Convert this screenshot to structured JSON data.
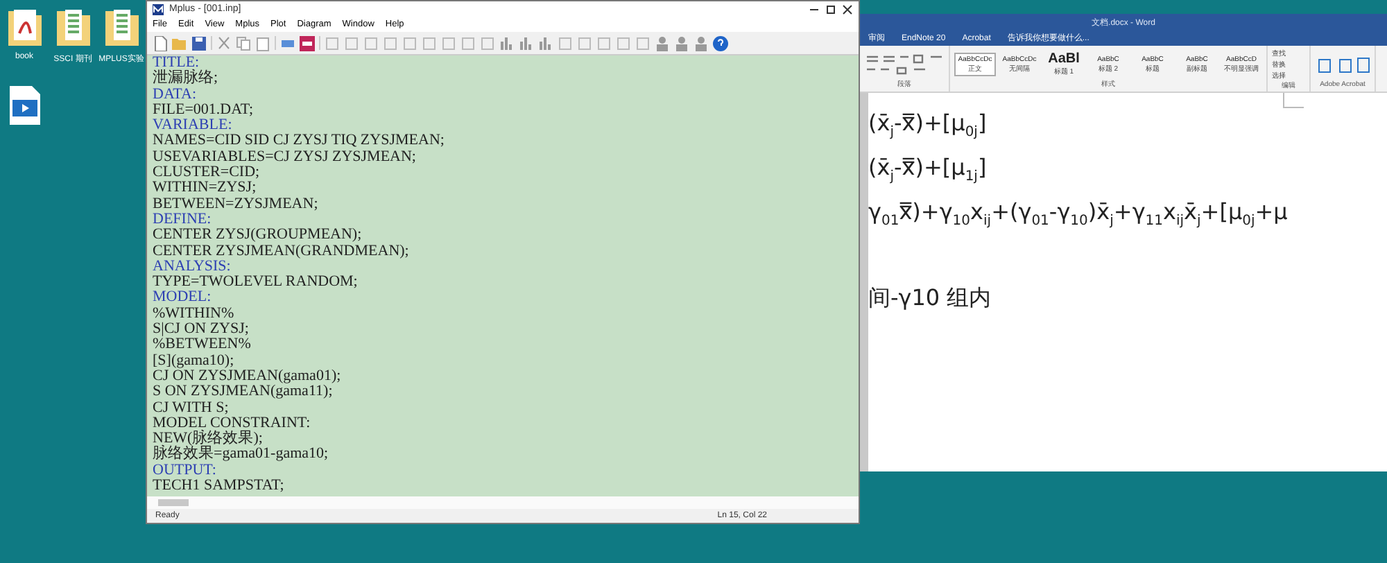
{
  "desktop_icons": [
    {
      "label": "book",
      "kind": "pdf-folder"
    },
    {
      "label": "SSCI 期刊",
      "kind": "folder"
    },
    {
      "label": "MPLUS实验",
      "kind": "folder"
    },
    {
      "kind": "video"
    }
  ],
  "mplus": {
    "title": "Mplus - [001.inp]",
    "menu": [
      "File",
      "Edit",
      "View",
      "Mplus",
      "Plot",
      "Diagram",
      "Window",
      "Help"
    ],
    "lines": [
      {
        "text": "TITLE:",
        "kind": "keyword"
      },
      {
        "text": "泄漏脉络;",
        "kind": "code"
      },
      {
        "text": "DATA:",
        "kind": "keyword"
      },
      {
        "text": "FILE=001.DAT;",
        "kind": "code"
      },
      {
        "text": "VARIABLE:",
        "kind": "keyword"
      },
      {
        "text": "NAMES=CID SID CJ ZYSJ TIQ ZYSJMEAN;",
        "kind": "code"
      },
      {
        "text": "USEVARIABLES=CJ ZYSJ ZYSJMEAN;",
        "kind": "code"
      },
      {
        "text": "CLUSTER=CID;",
        "kind": "code"
      },
      {
        "text": "WITHIN=ZYSJ;",
        "kind": "code"
      },
      {
        "text": "BETWEEN=ZYSJMEAN;",
        "kind": "code"
      },
      {
        "text": "DEFINE:",
        "kind": "keyword"
      },
      {
        "text": "CENTER ZYSJ(GROUPMEAN);",
        "kind": "code"
      },
      {
        "text": "CENTER ZYSJMEAN(GRANDMEAN);",
        "kind": "code"
      },
      {
        "text": "ANALYSIS:",
        "kind": "keyword"
      },
      {
        "text": "TYPE=TWOLEVEL RANDOM;",
        "kind": "code"
      },
      {
        "text": "MODEL:",
        "kind": "keyword"
      },
      {
        "text": "%WITHIN%",
        "kind": "code"
      },
      {
        "text": "S|CJ ON ZYSJ;",
        "kind": "code"
      },
      {
        "text": "%BETWEEN%",
        "kind": "code"
      },
      {
        "text": "[S](gama10);",
        "kind": "code"
      },
      {
        "text": "CJ ON ZYSJMEAN(gama01);",
        "kind": "code"
      },
      {
        "text": "S ON ZYSJMEAN(gama11);",
        "kind": "code"
      },
      {
        "text": "CJ WITH S;",
        "kind": "code"
      },
      {
        "text": "MODEL CONSTRAINT:",
        "kind": "code"
      },
      {
        "text": "NEW(脉络效果);",
        "kind": "code"
      },
      {
        "text": "脉络效果=gama01-gama10;",
        "kind": "code"
      },
      {
        "text": "OUTPUT:",
        "kind": "keyword"
      },
      {
        "text": "TECH1 SAMPSTAT;",
        "kind": "code"
      }
    ],
    "status": "Ready",
    "position": "Ln 15, Col 22"
  },
  "word": {
    "title": "文档.docx - Word",
    "tabs": [
      "审阅",
      "EndNote 20",
      "Acrobat"
    ],
    "tell_me": "告诉我你想要做什么...",
    "styles": [
      {
        "sample": "AaBbCcDc",
        "label": "正文",
        "selected": true
      },
      {
        "sample": "AaBbCcDc",
        "label": "无间隔",
        "selected": false
      },
      {
        "sample": "AaBl",
        "label": "标题 1",
        "selected": false
      },
      {
        "sample": "AaBbC",
        "label": "标题 2",
        "selected": false
      },
      {
        "sample": "AaBbC",
        "label": "标题",
        "selected": false
      },
      {
        "sample": "AaBbC",
        "label": "副标题",
        "selected": false
      },
      {
        "sample": "AaBbCcD",
        "label": "不明显强调",
        "selected": false
      }
    ],
    "editing": [
      "查找",
      "替换",
      "选择"
    ],
    "groups": [
      "段落",
      "样式",
      "编辑",
      "Adobe Acrobat"
    ],
    "formulas": [
      "(x̄$_{j}$-x̿)+[μ$_{0j}$]",
      "(x̄$_{j}$-x̿)+[μ$_{1j}$]",
      "γ$_{01}$x̿)+γ$_{10}$x$_{ij}$+(γ$_{01}$-γ$_{10}$)x̄$_{j}$+γ$_{11}$x$_{ij}$x̄$_{j}$+[μ$_{0j}$+μ",
      "间-γ10 组内"
    ]
  }
}
